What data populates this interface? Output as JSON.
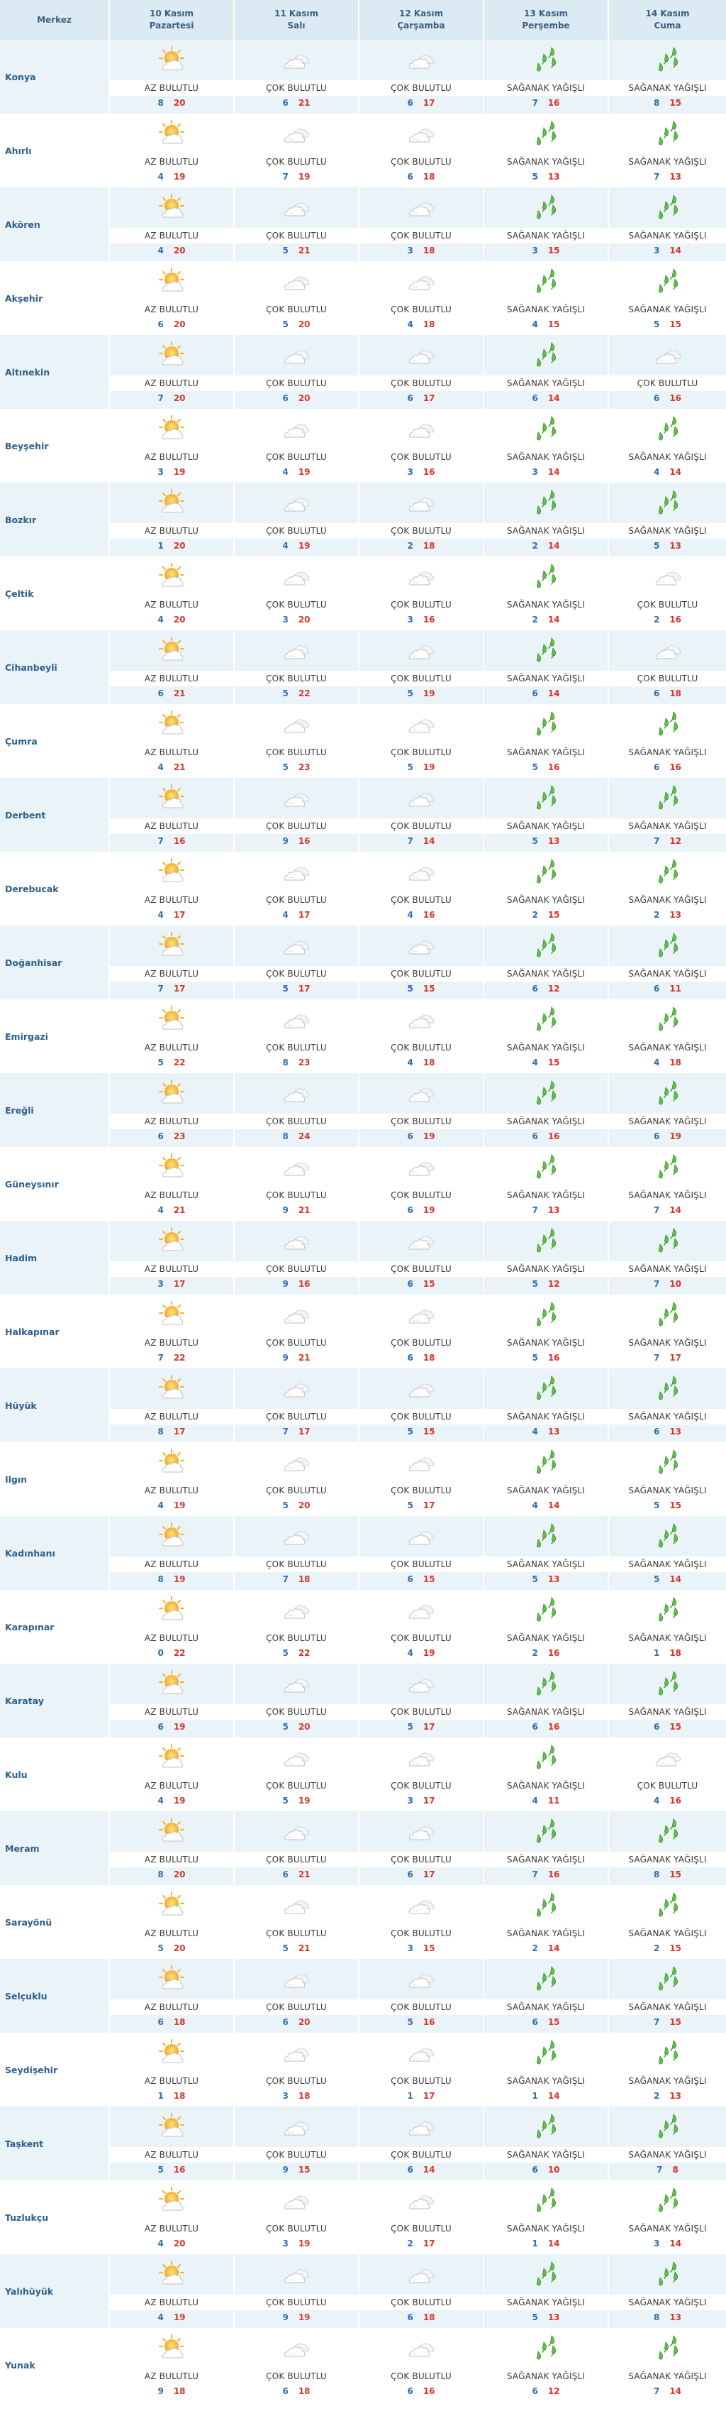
{
  "header": {
    "city_label": "Merkez",
    "days": [
      {
        "date": "10 Kasım",
        "weekday": "Pazartesi"
      },
      {
        "date": "11 Kasım",
        "weekday": "Salı"
      },
      {
        "date": "12 Kasım",
        "weekday": "Çarşamba"
      },
      {
        "date": "13 Kasım",
        "weekday": "Perşembe"
      },
      {
        "date": "14 Kasım",
        "weekday": "Cuma"
      }
    ]
  },
  "labels": {
    "AB": "AZ BULUTLU",
    "CB": "ÇOK BULUTLU",
    "SY": "SAĞANAK YAĞIŞLI"
  },
  "icons": {
    "AB": "partly-cloudy-sun-icon",
    "CB": "cloudy-icon",
    "SY": "shower-rain-icon"
  },
  "colors": {
    "header_bg": "#dbeaf3",
    "row_alt_bg": "#eaf3f8",
    "city_text": "#2f5f8a",
    "temp_low": "#2f6eb3",
    "temp_high": "#d9362b"
  },
  "rows": [
    {
      "city": "Konya",
      "days": [
        [
          "AB",
          8,
          20
        ],
        [
          "CB",
          6,
          21
        ],
        [
          "CB",
          6,
          17
        ],
        [
          "SY",
          7,
          16
        ],
        [
          "SY",
          8,
          15
        ]
      ]
    },
    {
      "city": "Ahırlı",
      "days": [
        [
          "AB",
          4,
          19
        ],
        [
          "CB",
          7,
          19
        ],
        [
          "CB",
          6,
          18
        ],
        [
          "SY",
          5,
          13
        ],
        [
          "SY",
          7,
          13
        ]
      ]
    },
    {
      "city": "Akören",
      "days": [
        [
          "AB",
          4,
          20
        ],
        [
          "CB",
          5,
          21
        ],
        [
          "CB",
          3,
          18
        ],
        [
          "SY",
          3,
          15
        ],
        [
          "SY",
          3,
          14
        ]
      ]
    },
    {
      "city": "Akşehir",
      "days": [
        [
          "AB",
          6,
          20
        ],
        [
          "CB",
          5,
          20
        ],
        [
          "CB",
          4,
          18
        ],
        [
          "SY",
          4,
          15
        ],
        [
          "SY",
          5,
          15
        ]
      ]
    },
    {
      "city": "Altınekin",
      "days": [
        [
          "AB",
          7,
          20
        ],
        [
          "CB",
          6,
          20
        ],
        [
          "CB",
          6,
          17
        ],
        [
          "SY",
          6,
          14
        ],
        [
          "CB",
          6,
          16
        ]
      ]
    },
    {
      "city": "Beyşehir",
      "days": [
        [
          "AB",
          3,
          19
        ],
        [
          "CB",
          4,
          19
        ],
        [
          "CB",
          3,
          16
        ],
        [
          "SY",
          3,
          14
        ],
        [
          "SY",
          4,
          14
        ]
      ]
    },
    {
      "city": "Bozkır",
      "days": [
        [
          "AB",
          1,
          20
        ],
        [
          "CB",
          4,
          19
        ],
        [
          "CB",
          2,
          18
        ],
        [
          "SY",
          2,
          14
        ],
        [
          "SY",
          5,
          13
        ]
      ]
    },
    {
      "city": "Çeltik",
      "days": [
        [
          "AB",
          4,
          20
        ],
        [
          "CB",
          3,
          20
        ],
        [
          "CB",
          3,
          16
        ],
        [
          "SY",
          2,
          14
        ],
        [
          "CB",
          2,
          16
        ]
      ]
    },
    {
      "city": "Cihanbeyli",
      "days": [
        [
          "AB",
          6,
          21
        ],
        [
          "CB",
          5,
          22
        ],
        [
          "CB",
          5,
          19
        ],
        [
          "SY",
          6,
          14
        ],
        [
          "CB",
          6,
          18
        ]
      ]
    },
    {
      "city": "Çumra",
      "days": [
        [
          "AB",
          4,
          21
        ],
        [
          "CB",
          5,
          23
        ],
        [
          "CB",
          5,
          19
        ],
        [
          "SY",
          5,
          16
        ],
        [
          "SY",
          6,
          16
        ]
      ]
    },
    {
      "city": "Derbent",
      "days": [
        [
          "AB",
          7,
          16
        ],
        [
          "CB",
          9,
          16
        ],
        [
          "CB",
          7,
          14
        ],
        [
          "SY",
          5,
          13
        ],
        [
          "SY",
          7,
          12
        ]
      ]
    },
    {
      "city": "Derebucak",
      "days": [
        [
          "AB",
          4,
          17
        ],
        [
          "CB",
          4,
          17
        ],
        [
          "CB",
          4,
          16
        ],
        [
          "SY",
          2,
          15
        ],
        [
          "SY",
          2,
          13
        ]
      ]
    },
    {
      "city": "Doğanhisar",
      "days": [
        [
          "AB",
          7,
          17
        ],
        [
          "CB",
          5,
          17
        ],
        [
          "CB",
          5,
          15
        ],
        [
          "SY",
          6,
          12
        ],
        [
          "SY",
          6,
          11
        ]
      ]
    },
    {
      "city": "Emirgazi",
      "days": [
        [
          "AB",
          5,
          22
        ],
        [
          "CB",
          8,
          23
        ],
        [
          "CB",
          4,
          18
        ],
        [
          "SY",
          4,
          15
        ],
        [
          "SY",
          4,
          18
        ]
      ]
    },
    {
      "city": "Ereğli",
      "days": [
        [
          "AB",
          6,
          23
        ],
        [
          "CB",
          8,
          24
        ],
        [
          "CB",
          6,
          19
        ],
        [
          "SY",
          6,
          16
        ],
        [
          "SY",
          6,
          19
        ]
      ]
    },
    {
      "city": "Güneysınır",
      "days": [
        [
          "AB",
          4,
          21
        ],
        [
          "CB",
          9,
          21
        ],
        [
          "CB",
          6,
          19
        ],
        [
          "SY",
          7,
          13
        ],
        [
          "SY",
          7,
          14
        ]
      ]
    },
    {
      "city": "Hadim",
      "days": [
        [
          "AB",
          3,
          17
        ],
        [
          "CB",
          9,
          16
        ],
        [
          "CB",
          6,
          15
        ],
        [
          "SY",
          5,
          12
        ],
        [
          "SY",
          7,
          10
        ]
      ]
    },
    {
      "city": "Halkapınar",
      "days": [
        [
          "AB",
          7,
          22
        ],
        [
          "CB",
          9,
          21
        ],
        [
          "CB",
          6,
          18
        ],
        [
          "SY",
          5,
          16
        ],
        [
          "SY",
          7,
          17
        ]
      ]
    },
    {
      "city": "Hüyük",
      "days": [
        [
          "AB",
          8,
          17
        ],
        [
          "CB",
          7,
          17
        ],
        [
          "CB",
          5,
          15
        ],
        [
          "SY",
          4,
          13
        ],
        [
          "SY",
          6,
          13
        ]
      ]
    },
    {
      "city": "Ilgın",
      "days": [
        [
          "AB",
          4,
          19
        ],
        [
          "CB",
          5,
          20
        ],
        [
          "CB",
          5,
          17
        ],
        [
          "SY",
          4,
          14
        ],
        [
          "SY",
          5,
          15
        ]
      ]
    },
    {
      "city": "Kadınhanı",
      "days": [
        [
          "AB",
          8,
          19
        ],
        [
          "CB",
          7,
          18
        ],
        [
          "CB",
          6,
          15
        ],
        [
          "SY",
          5,
          13
        ],
        [
          "SY",
          5,
          14
        ]
      ]
    },
    {
      "city": "Karapınar",
      "days": [
        [
          "AB",
          0,
          22
        ],
        [
          "CB",
          5,
          22
        ],
        [
          "CB",
          4,
          19
        ],
        [
          "SY",
          2,
          16
        ],
        [
          "SY",
          1,
          18
        ]
      ]
    },
    {
      "city": "Karatay",
      "days": [
        [
          "AB",
          6,
          19
        ],
        [
          "CB",
          5,
          20
        ],
        [
          "CB",
          5,
          17
        ],
        [
          "SY",
          6,
          16
        ],
        [
          "SY",
          6,
          15
        ]
      ]
    },
    {
      "city": "Kulu",
      "days": [
        [
          "AB",
          4,
          19
        ],
        [
          "CB",
          5,
          19
        ],
        [
          "CB",
          3,
          17
        ],
        [
          "SY",
          4,
          11
        ],
        [
          "CB",
          4,
          16
        ]
      ]
    },
    {
      "city": "Meram",
      "days": [
        [
          "AB",
          8,
          20
        ],
        [
          "CB",
          6,
          21
        ],
        [
          "CB",
          6,
          17
        ],
        [
          "SY",
          7,
          16
        ],
        [
          "SY",
          8,
          15
        ]
      ]
    },
    {
      "city": "Sarayönü",
      "days": [
        [
          "AB",
          5,
          20
        ],
        [
          "CB",
          5,
          21
        ],
        [
          "CB",
          3,
          15
        ],
        [
          "SY",
          2,
          14
        ],
        [
          "SY",
          2,
          15
        ]
      ]
    },
    {
      "city": "Selçuklu",
      "days": [
        [
          "AB",
          6,
          18
        ],
        [
          "CB",
          6,
          20
        ],
        [
          "CB",
          5,
          16
        ],
        [
          "SY",
          6,
          15
        ],
        [
          "SY",
          7,
          15
        ]
      ]
    },
    {
      "city": "Seydişehir",
      "days": [
        [
          "AB",
          1,
          18
        ],
        [
          "CB",
          3,
          18
        ],
        [
          "CB",
          1,
          17
        ],
        [
          "SY",
          1,
          14
        ],
        [
          "SY",
          2,
          13
        ]
      ]
    },
    {
      "city": "Taşkent",
      "days": [
        [
          "AB",
          5,
          16
        ],
        [
          "CB",
          9,
          15
        ],
        [
          "CB",
          6,
          14
        ],
        [
          "SY",
          6,
          10
        ],
        [
          "SY",
          7,
          8
        ]
      ]
    },
    {
      "city": "Tuzlukçu",
      "days": [
        [
          "AB",
          4,
          20
        ],
        [
          "CB",
          3,
          19
        ],
        [
          "CB",
          2,
          17
        ],
        [
          "SY",
          1,
          14
        ],
        [
          "SY",
          3,
          14
        ]
      ]
    },
    {
      "city": "Yalıhüyük",
      "days": [
        [
          "AB",
          4,
          19
        ],
        [
          "CB",
          9,
          19
        ],
        [
          "CB",
          6,
          18
        ],
        [
          "SY",
          5,
          13
        ],
        [
          "SY",
          8,
          13
        ]
      ]
    },
    {
      "city": "Yunak",
      "days": [
        [
          "AB",
          9,
          18
        ],
        [
          "CB",
          6,
          18
        ],
        [
          "CB",
          6,
          16
        ],
        [
          "SY",
          6,
          12
        ],
        [
          "SY",
          7,
          14
        ]
      ]
    }
  ]
}
